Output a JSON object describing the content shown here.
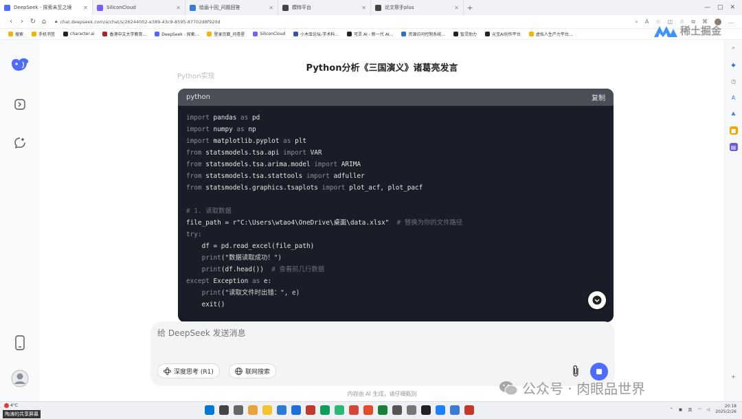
{
  "browser": {
    "tabs": [
      {
        "title": "DeepSeek - 探索未至之境",
        "color": "#4d6bfe",
        "active": true
      },
      {
        "title": "SiliconCloud",
        "color": "#7b5cff",
        "active": false
      },
      {
        "title": "绘画十回_问题回答",
        "color": "#3a7bd5",
        "active": false
      },
      {
        "title": "模特平台",
        "color": "#444444",
        "active": false
      },
      {
        "title": "论文帮手plus",
        "color": "#444444",
        "active": false
      }
    ],
    "url": "chat.deepseek.com/a/chat/s/26244002-e389-43c9-8595-87702d8f920d",
    "bookmarks": [
      {
        "label": "搜索",
        "color": "#f4b400"
      },
      {
        "label": "手机书签",
        "color": "#f4b400"
      },
      {
        "label": "character.ai",
        "color": "#222222"
      },
      {
        "label": "香港中文大学教育...",
        "color": "#b22222"
      },
      {
        "label": "DeepSeek - 探索...",
        "color": "#4d6bfe"
      },
      {
        "label": "登录页面_问卷星",
        "color": "#f4b400"
      },
      {
        "label": "SiliconCloud",
        "color": "#7b5cff"
      },
      {
        "label": "小木虫论坛-学术科...",
        "color": "#3355aa"
      },
      {
        "label": "可灵 AI - 新一代 AI...",
        "color": "#222222"
      },
      {
        "label": "资源访问控制系统...",
        "color": "#2a6fd6"
      },
      {
        "label": "智灵助力",
        "color": "#222222"
      },
      {
        "label": "元宝AI创作平台",
        "color": "#222222"
      },
      {
        "label": "虚拟人生产力平台...",
        "color": "#f4b400"
      }
    ],
    "watermark_top": "稀土掘金"
  },
  "conversation": {
    "title": "Python分析《三国演义》诸葛亮发言",
    "faded_line": "Python实现"
  },
  "code_block": {
    "language": "python",
    "copy_label": "复制",
    "lines": [
      [
        {
          "t": "import",
          "c": "kw"
        },
        {
          "t": " pandas ",
          "c": ""
        },
        {
          "t": "as",
          "c": "kw"
        },
        {
          "t": " pd",
          "c": ""
        }
      ],
      [
        {
          "t": "import",
          "c": "kw"
        },
        {
          "t": " numpy ",
          "c": ""
        },
        {
          "t": "as",
          "c": "kw"
        },
        {
          "t": " np",
          "c": ""
        }
      ],
      [
        {
          "t": "import",
          "c": "kw"
        },
        {
          "t": " matplotlib.pyplot ",
          "c": ""
        },
        {
          "t": "as",
          "c": "kw"
        },
        {
          "t": " plt",
          "c": ""
        }
      ],
      [
        {
          "t": "from",
          "c": "kw"
        },
        {
          "t": " statsmodels.tsa.api ",
          "c": ""
        },
        {
          "t": "import",
          "c": "kw"
        },
        {
          "t": " VAR",
          "c": ""
        }
      ],
      [
        {
          "t": "from",
          "c": "kw"
        },
        {
          "t": " statsmodels.tsa.arima.model ",
          "c": ""
        },
        {
          "t": "import",
          "c": "kw"
        },
        {
          "t": " ARIMA",
          "c": ""
        }
      ],
      [
        {
          "t": "from",
          "c": "kw"
        },
        {
          "t": " statsmodels.tsa.stattools ",
          "c": ""
        },
        {
          "t": "import",
          "c": "kw"
        },
        {
          "t": " adfuller",
          "c": ""
        }
      ],
      [
        {
          "t": "from",
          "c": "kw"
        },
        {
          "t": " statsmodels.graphics.tsaplots ",
          "c": ""
        },
        {
          "t": "import",
          "c": "kw"
        },
        {
          "t": " plot_acf, plot_pacf",
          "c": ""
        }
      ],
      [],
      [
        {
          "t": "# 1. 读取数据",
          "c": "cm"
        }
      ],
      [
        {
          "t": "file_path = r\"C:\\Users\\wtao4\\OneDrive\\桌面\\data.xlsx\"",
          "c": ""
        },
        {
          "t": "  # 替换为你的文件路径",
          "c": "cm"
        }
      ],
      [
        {
          "t": "try:",
          "c": "kw"
        }
      ],
      [
        {
          "t": "    df = pd.read_excel(file_path)",
          "c": ""
        }
      ],
      [
        {
          "t": "    print",
          "c": "kw"
        },
        {
          "t": "(\"数据读取成功！\")",
          "c": "st"
        }
      ],
      [
        {
          "t": "    print",
          "c": "kw"
        },
        {
          "t": "(df.head())",
          "c": ""
        },
        {
          "t": "  # 查看前几行数据",
          "c": "cm"
        }
      ],
      [
        {
          "t": "except",
          "c": "kw"
        },
        {
          "t": " Exception ",
          "c": ""
        },
        {
          "t": "as",
          "c": "kw"
        },
        {
          "t": " e:",
          "c": ""
        }
      ],
      [
        {
          "t": "    print",
          "c": "kw"
        },
        {
          "t": "(\"读取文件时出错：\", e)",
          "c": "st"
        }
      ],
      [
        {
          "t": "    exit()",
          "c": ""
        }
      ]
    ]
  },
  "composer": {
    "placeholder": "给 DeepSeek 发送消息",
    "deep_think_label": "深度思考 (R1)",
    "web_search_label": "联网搜索"
  },
  "disclaimer": "内容由 AI 生成，请仔细甄别",
  "watermark_bottom": "公众号 · 肉眼品世界",
  "taskbar": {
    "share_label": "陶涛的共享屏幕",
    "time": "20:18",
    "date": "2025/2/26",
    "weather": "4°C"
  },
  "colors": {
    "accent": "#4d6bfe",
    "code_bg": "#181d27",
    "code_header": "#4a4e57"
  }
}
